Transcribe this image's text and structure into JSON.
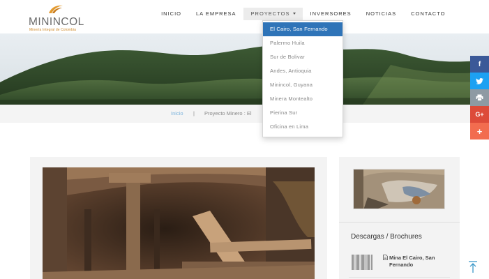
{
  "logo": {
    "name": "MININCOL",
    "tagline": "Minería Integral de Colombia",
    "brand_color": "#d08a2a"
  },
  "nav": {
    "items": [
      {
        "label": "INICIO"
      },
      {
        "label": "LA EMPRESA"
      },
      {
        "label": "PROYECTOS",
        "has_caret": true,
        "active": true
      },
      {
        "label": "INVERSORES"
      },
      {
        "label": "NOTICIAS"
      },
      {
        "label": "CONTACTO"
      }
    ]
  },
  "dropdown": {
    "items": [
      {
        "label": "El Cairo, San Fernando",
        "selected": true
      },
      {
        "label": "Palermo Huila"
      },
      {
        "label": "Sur de Bolivar"
      },
      {
        "label": "Andes, Antioquia"
      },
      {
        "label": "Minincol, Guyana"
      },
      {
        "label": "Minera Montealto"
      },
      {
        "label": "Pierina Sur"
      },
      {
        "label": "Oficina en Lima"
      }
    ],
    "selected_color": "#2f74b8"
  },
  "breadcrumb": {
    "home": "Inicio",
    "separator": "|",
    "current": "Proyecto Minero : El"
  },
  "social": [
    {
      "icon": "facebook-icon",
      "glyph": "f",
      "color": "#3b5998"
    },
    {
      "icon": "twitter-icon",
      "glyph": "t",
      "color": "#1da1f2"
    },
    {
      "icon": "print-icon",
      "glyph": "⎙",
      "color": "#8e9aa3"
    },
    {
      "icon": "google-plus-icon",
      "glyph": "G+",
      "color": "#dd4b39"
    },
    {
      "icon": "share-plus-icon",
      "glyph": "+",
      "color": "#f26c4f"
    }
  ],
  "sidebar": {
    "title": "Descargas / Brochures",
    "downloads": [
      {
        "label": "Mina El Cairo, San Fernando",
        "icon": "document-icon"
      }
    ]
  },
  "back_to_top": {
    "icon": "arrow-up-icon",
    "color": "#2a8fc4"
  }
}
